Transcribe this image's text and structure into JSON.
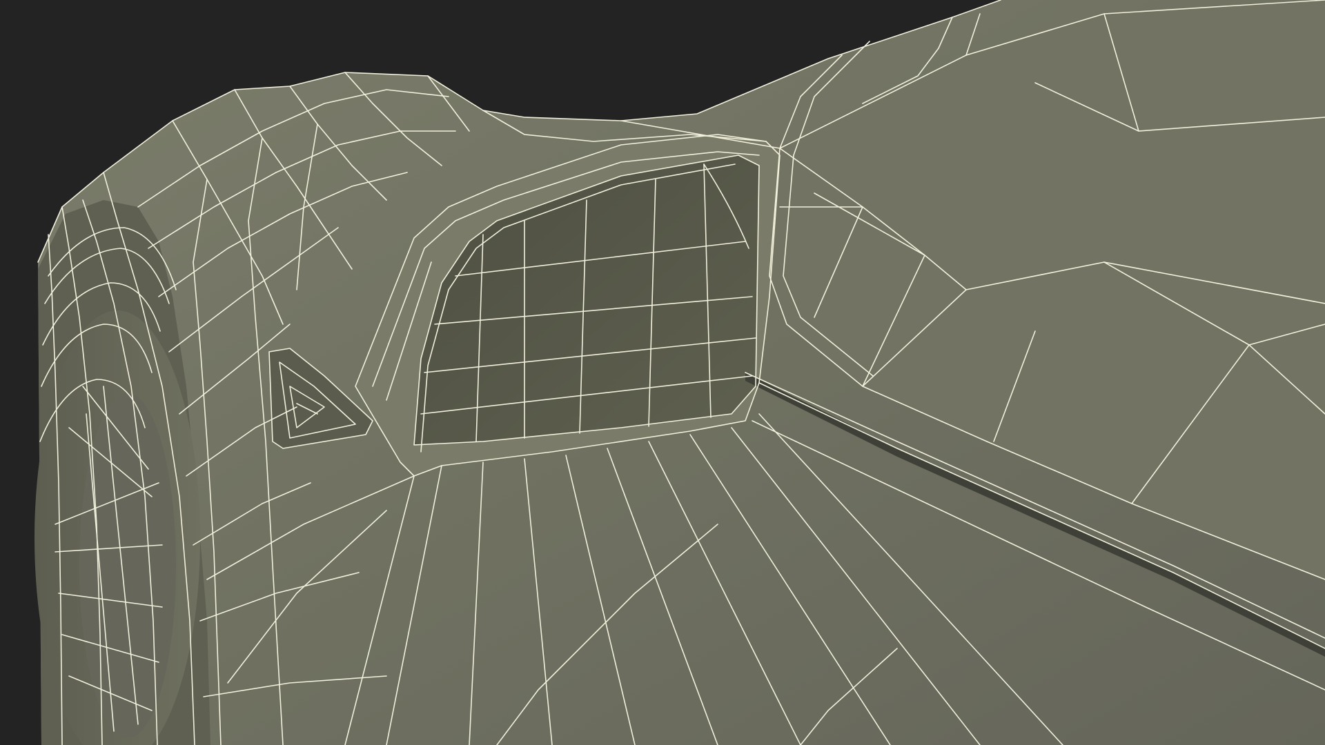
{
  "scene": {
    "subject": "car-side-mirror-wireframe-render",
    "colors": {
      "background": "#232323",
      "surface_light": "#7a7b69",
      "surface_mid": "#6c6d5c",
      "surface_dark": "#55564a",
      "mirror_glass": "#5a5b4c",
      "shadow": "#3f4037",
      "wire": "#f1f0dc"
    }
  }
}
